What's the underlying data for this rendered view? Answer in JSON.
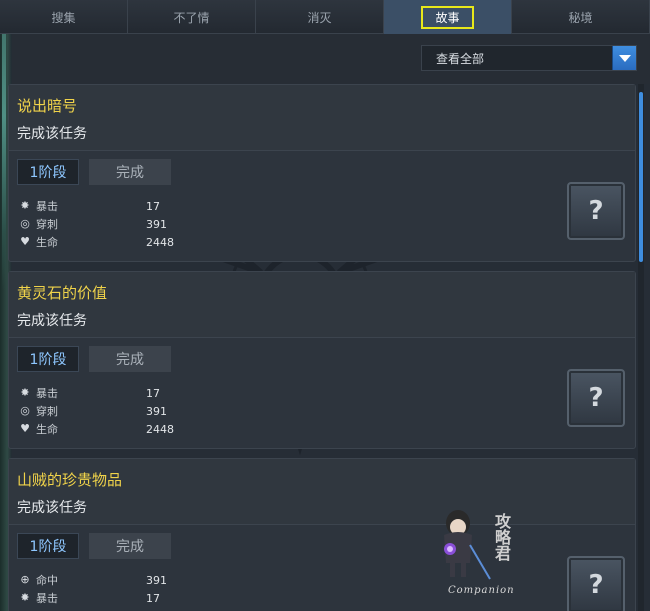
{
  "tabs": [
    {
      "label": "搜集"
    },
    {
      "label": "不了情"
    },
    {
      "label": "消灭"
    },
    {
      "label": "故事",
      "active": true
    },
    {
      "label": "秘境"
    }
  ],
  "filter": {
    "selected": "查看全部"
  },
  "quests": [
    {
      "title": "说出暗号",
      "desc": "完成该任务",
      "stage": "1阶段",
      "complete": "完成",
      "reward": "?",
      "stats": [
        {
          "icon": "crit-icon",
          "name": "暴击",
          "value": "17"
        },
        {
          "icon": "pierce-icon",
          "name": "穿刺",
          "value": "391"
        },
        {
          "icon": "heart-icon",
          "name": "生命",
          "value": "2448"
        }
      ]
    },
    {
      "title": "黄灵石的价值",
      "desc": "完成该任务",
      "stage": "1阶段",
      "complete": "完成",
      "reward": "?",
      "stats": [
        {
          "icon": "crit-icon",
          "name": "暴击",
          "value": "17"
        },
        {
          "icon": "pierce-icon",
          "name": "穿刺",
          "value": "391"
        },
        {
          "icon": "heart-icon",
          "name": "生命",
          "value": "2448"
        }
      ]
    },
    {
      "title": "山贼的珍贵物品",
      "desc": "完成该任务",
      "stage": "1阶段",
      "complete": "完成",
      "reward": "?",
      "stats": [
        {
          "icon": "accuracy-icon",
          "name": "命中",
          "value": "391"
        },
        {
          "icon": "crit-icon",
          "name": "暴击",
          "value": "17"
        }
      ]
    }
  ],
  "watermark": {
    "brand": "Companion",
    "script": "攻略君"
  },
  "colors": {
    "accent": "#3f8ee0",
    "title": "#f0d34a",
    "stage_text": "#8ec7ff",
    "active_tab_outline": "#e8e81a"
  }
}
